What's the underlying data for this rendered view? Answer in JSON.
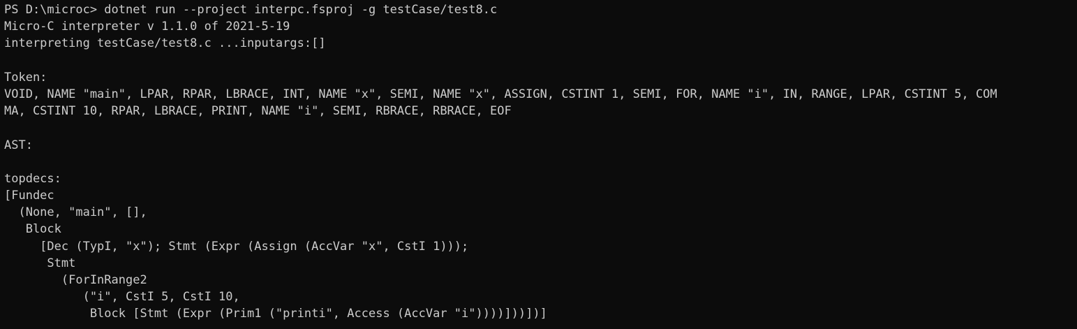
{
  "terminal": {
    "colors": {
      "background": "#0c0c0c",
      "foreground": "#cccccc"
    },
    "lines": [
      "PS D:\\microc> dotnet run --project interpc.fsproj -g testCase/test8.c",
      "Micro-C interpreter v 1.1.0 of 2021-5-19",
      "interpreting testCase/test8.c ...inputargs:[]",
      "",
      "Token:",
      "VOID, NAME \"main\", LPAR, RPAR, LBRACE, INT, NAME \"x\", SEMI, NAME \"x\", ASSIGN, CSTINT 1, SEMI, FOR, NAME \"i\", IN, RANGE, LPAR, CSTINT 5, COM",
      "MA, CSTINT 10, RPAR, LBRACE, PRINT, NAME \"i\", SEMI, RBRACE, RBRACE, EOF",
      "",
      "AST:",
      "",
      "topdecs:",
      "[Fundec",
      "  (None, \"main\", [],",
      "   Block",
      "     [Dec (TypI, \"x\"); Stmt (Expr (Assign (AccVar \"x\", CstI 1)));",
      "      Stmt",
      "        (ForInRange2",
      "           (\"i\", CstI 5, CstI 10,",
      "            Block [Stmt (Expr (Prim1 (\"printi\", Access (AccVar \"i\"))))]))])]"
    ]
  }
}
